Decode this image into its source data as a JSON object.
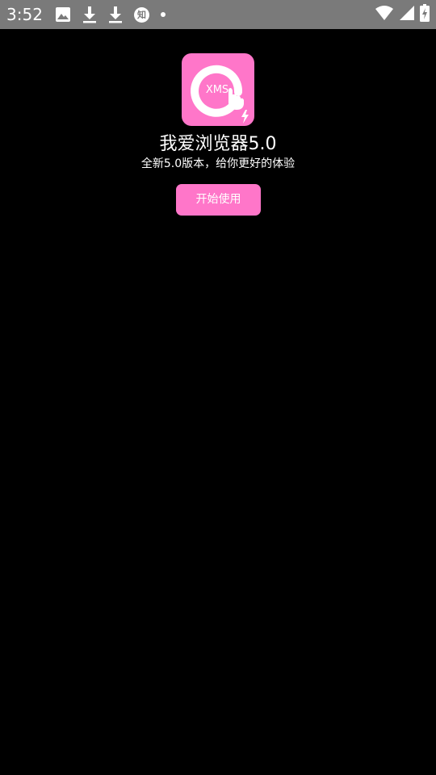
{
  "status_bar": {
    "time": "3:52",
    "left_icons": [
      "image-icon",
      "download-icon",
      "download-icon",
      "zhihu-icon",
      "dot-icon"
    ],
    "zhihu_badge": "知",
    "right_icons": [
      "wifi-icon",
      "signal-icon",
      "battery-charging-icon"
    ],
    "background": "#7a7a7a"
  },
  "app": {
    "logo_text": "XMS",
    "title": "我爱浏览器5.0",
    "subtitle": "全新5.0版本，给你更好的体验",
    "start_button_label": "开始使用",
    "accent_color": "#ff76c9"
  }
}
